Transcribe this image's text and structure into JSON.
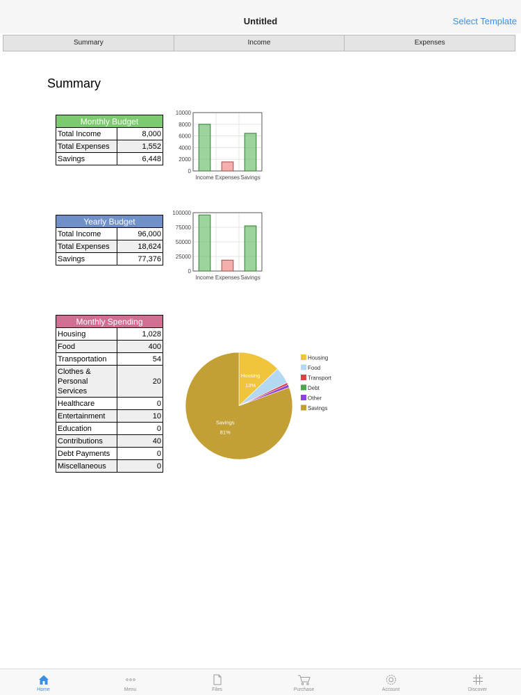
{
  "navbar": {
    "title": "Untitled",
    "right_action": "Select Template"
  },
  "tabs": [
    {
      "label": "Summary"
    },
    {
      "label": "Income"
    },
    {
      "label": "Expenses"
    }
  ],
  "page_heading": "Summary",
  "monthly_budget": {
    "title": "Monthly Budget",
    "rows": [
      {
        "label": "Total Income",
        "value": "8,000"
      },
      {
        "label": "Total Expenses",
        "value": "1,552"
      },
      {
        "label": "Savings",
        "value": "6,448"
      }
    ]
  },
  "yearly_budget": {
    "title": "Yearly Budget",
    "rows": [
      {
        "label": "Total Income",
        "value": "96,000"
      },
      {
        "label": "Total Expenses",
        "value": "18,624"
      },
      {
        "label": "Savings",
        "value": "77,376"
      }
    ]
  },
  "monthly_spending": {
    "title": "Monthly Spending",
    "rows": [
      {
        "label": "Housing",
        "value": "1,028"
      },
      {
        "label": "Food",
        "value": "400"
      },
      {
        "label": "Transportation",
        "value": "54"
      },
      {
        "label": "Clothes & Personal Services",
        "value": "20"
      },
      {
        "label": "Healthcare",
        "value": "0"
      },
      {
        "label": "Entertainment",
        "value": "10"
      },
      {
        "label": "Education",
        "value": "0"
      },
      {
        "label": "Contributions",
        "value": "40"
      },
      {
        "label": "Debt Payments",
        "value": "0"
      },
      {
        "label": "Miscellaneous",
        "value": "0"
      }
    ]
  },
  "chart_data": [
    {
      "type": "bar",
      "categories": [
        "Income",
        "Expenses",
        "Savings"
      ],
      "values": [
        8000,
        1552,
        6448
      ],
      "ylim": [
        0,
        10000
      ],
      "yticks": [
        0,
        2000,
        4000,
        6000,
        8000,
        10000
      ],
      "colors": [
        "#5cb85c",
        "#f07a7a",
        "#5cb85c"
      ],
      "grid": true
    },
    {
      "type": "bar",
      "categories": [
        "Income",
        "Expenses",
        "Savings"
      ],
      "values": [
        96000,
        18624,
        77376
      ],
      "ylim": [
        0,
        100000
      ],
      "yticks": [
        0,
        25000,
        50000,
        75000,
        100000
      ],
      "colors": [
        "#5cb85c",
        "#f07a7a",
        "#5cb85c"
      ],
      "grid": true
    },
    {
      "type": "pie",
      "slices": [
        {
          "name": "Housing",
          "value": 1028,
          "color": "#f0c43c",
          "label": "Housing",
          "pct_label": "13%"
        },
        {
          "name": "Food",
          "value": 400,
          "color": "#b5d8f2"
        },
        {
          "name": "Transport",
          "value": 54,
          "color": "#d94343"
        },
        {
          "name": "Debt",
          "value": 0,
          "color": "#4aa64a"
        },
        {
          "name": "Other",
          "value": 70,
          "color": "#8e44d6"
        },
        {
          "name": "Savings",
          "value": 6448,
          "color": "#c2a035",
          "label": "Savings",
          "pct_label": "81%"
        }
      ],
      "legend_position": "right"
    }
  ],
  "bottom_bar": [
    {
      "label": "Home",
      "icon": "home-icon",
      "active": true
    },
    {
      "label": "Menu",
      "icon": "more-dots-icon",
      "active": false
    },
    {
      "label": "Files",
      "icon": "file-icon",
      "active": false
    },
    {
      "label": "Purchase",
      "icon": "cart-icon",
      "active": false
    },
    {
      "label": "Account",
      "icon": "gear-icon",
      "active": false
    },
    {
      "label": "Discover",
      "icon": "hash-icon",
      "active": false
    }
  ],
  "colors": {
    "accent": "#3b8fe0"
  }
}
